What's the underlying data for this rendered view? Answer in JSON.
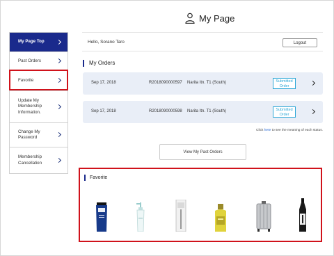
{
  "page": {
    "title": "My Page",
    "person_icon": "person-icon"
  },
  "sidebar": {
    "items": [
      {
        "label": "My Page Top",
        "active": true
      },
      {
        "label": "Past Orders",
        "active": false
      },
      {
        "label": "Favorite",
        "active": false
      },
      {
        "label": "Update My Membership Information.",
        "active": false
      },
      {
        "label": "Change My Password",
        "active": false
      },
      {
        "label": "Membership Cancellation",
        "active": false
      }
    ]
  },
  "header": {
    "greeting": "Hello, Sorano Taro",
    "logout_label": "Logout"
  },
  "orders": {
    "title": "My Orders",
    "rows": [
      {
        "date": "Sep 17, 2018",
        "number": "R2018090000597",
        "location": "Narita Itn. T1 (South)",
        "status": "Submitted Order"
      },
      {
        "date": "Sep 17, 2018",
        "number": "R2018090000598",
        "location": "Narita Itn. T1 (South)",
        "status": "Submitted Order"
      }
    ],
    "note_prefix": "Click ",
    "note_link": "here",
    "note_suffix": " to see the meaning of each status.",
    "view_past_label": "View My Past Orders"
  },
  "favorite": {
    "title": "Favorite",
    "products": [
      "blue-tube-product",
      "white-pump-bottle",
      "boxed-product",
      "yellow-lotion-bottle",
      "silver-suitcase",
      "sake-bottle"
    ]
  },
  "colors": {
    "accent": "#1a2a8c",
    "highlight": "#d0121b",
    "status": "#29a6d6",
    "order_bg": "#e9eef7"
  }
}
